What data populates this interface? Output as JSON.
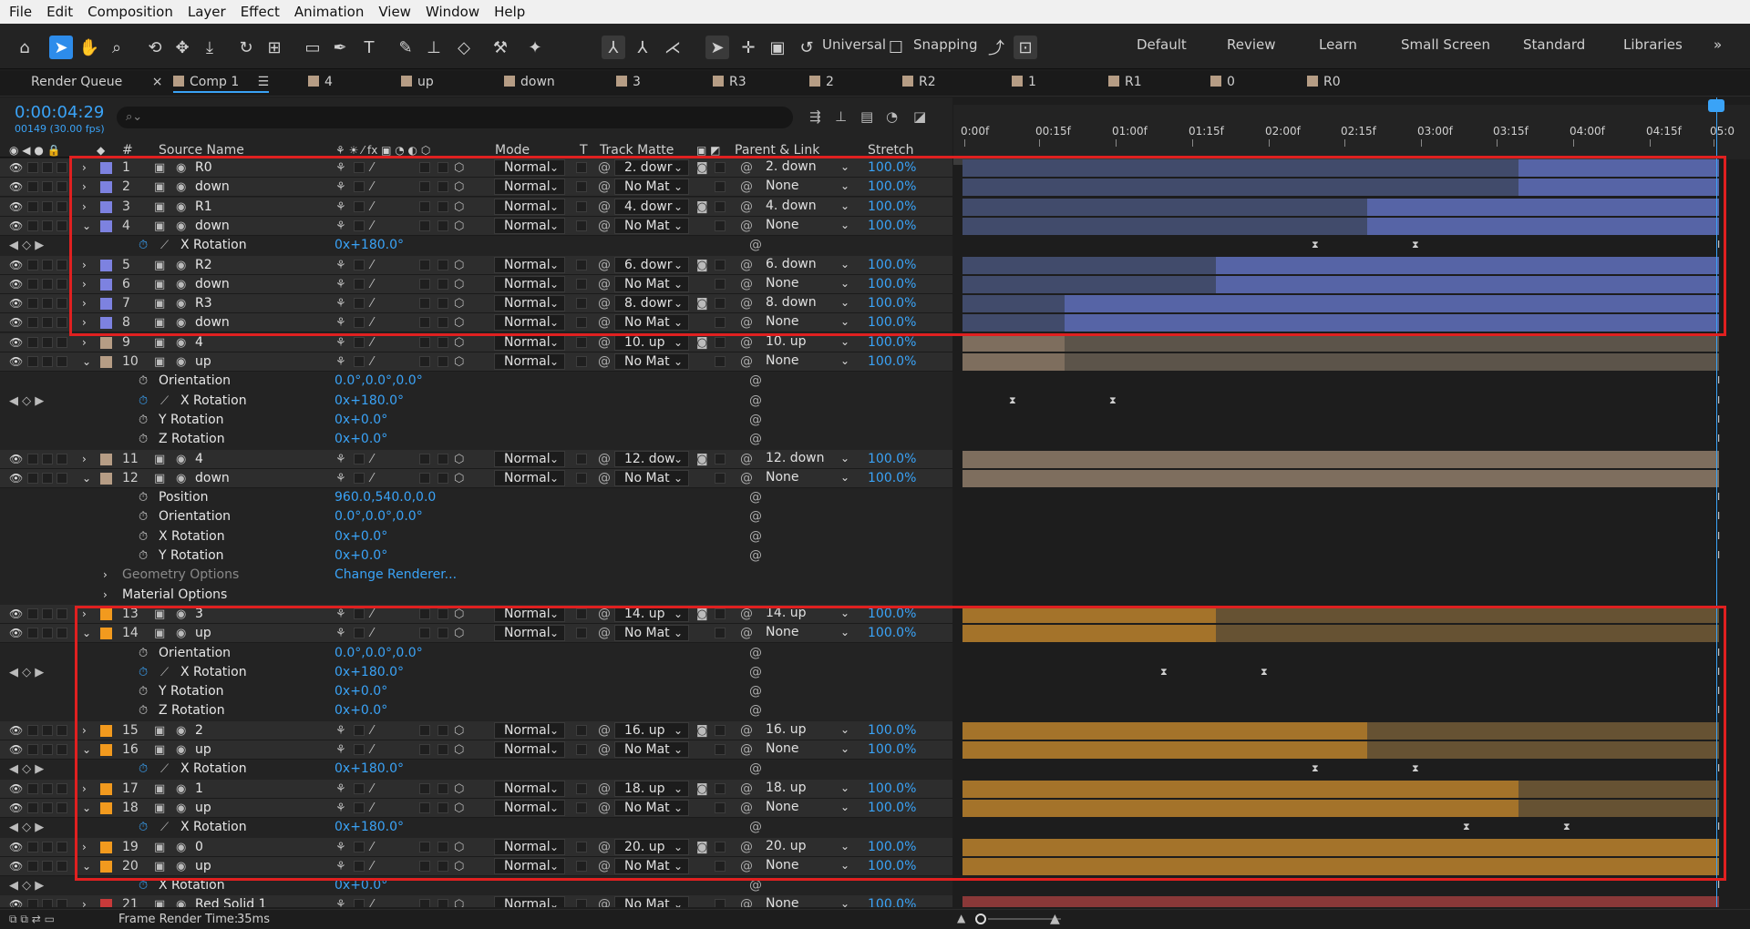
{
  "menu": [
    "File",
    "Edit",
    "Composition",
    "Layer",
    "Effect",
    "Animation",
    "View",
    "Window",
    "Help"
  ],
  "toolbar": {
    "universal_label": "Universal",
    "snapping_label": "Snapping",
    "workspaces": [
      "Default",
      "Review",
      "Learn",
      "Small Screen",
      "Standard",
      "Libraries"
    ],
    "more": "»"
  },
  "tabs": [
    {
      "label": "Render Queue",
      "color": null
    },
    {
      "label": "Comp 1",
      "color": "#b69d85",
      "active": true
    },
    {
      "label": "4",
      "color": "#b69d85"
    },
    {
      "label": "up",
      "color": "#b69d85"
    },
    {
      "label": "down",
      "color": "#b69d85"
    },
    {
      "label": "3",
      "color": "#b69d85"
    },
    {
      "label": "R3",
      "color": "#b69d85"
    },
    {
      "label": "2",
      "color": "#b69d85"
    },
    {
      "label": "R2",
      "color": "#b69d85"
    },
    {
      "label": "1",
      "color": "#b69d85"
    },
    {
      "label": "R1",
      "color": "#b69d85"
    },
    {
      "label": "0",
      "color": "#b69d85"
    },
    {
      "label": "R0",
      "color": "#b69d85"
    }
  ],
  "comp": {
    "timecode": "0:00:04:29",
    "fps": "00149 (30.00 fps)",
    "search_placeholder": "",
    "search_icon": "search-icon"
  },
  "columns": {
    "num": "#",
    "source_name": "Source Name",
    "mode": "Mode",
    "t": "T",
    "track_matte": "Track Matte",
    "parent_link": "Parent & Link",
    "stretch": "Stretch"
  },
  "ruler": [
    "0:00f",
    "00:15f",
    "01:00f",
    "01:15f",
    "02:00f",
    "02:15f",
    "03:00f",
    "03:15f",
    "04:00f",
    "04:15f",
    "05:0"
  ],
  "rows": [
    {
      "kind": "layer",
      "num": "1",
      "name": "R0",
      "color": "#7d82e0",
      "expanded": false,
      "mode": "Normal",
      "matte": "2. dowr",
      "matte_icon": true,
      "parent": "2. down",
      "stretch": "100.0%",
      "bar": {
        "start": 0,
        "end": 1,
        "hi": 0.735,
        "c1": "#414b6b",
        "c2": "#5664a6"
      }
    },
    {
      "kind": "layer",
      "num": "2",
      "name": "down",
      "color": "#7d82e0",
      "expanded": false,
      "mode": "Normal",
      "matte": "No Mat",
      "matte_icon": false,
      "parent": "None",
      "stretch": "100.0%",
      "bar": {
        "start": 0,
        "end": 1,
        "hi": 0.735,
        "c1": "#414b6b",
        "c2": "#5664a6"
      }
    },
    {
      "kind": "layer",
      "num": "3",
      "name": "R1",
      "color": "#7d82e0",
      "expanded": false,
      "mode": "Normal",
      "matte": "4. dowr",
      "matte_icon": true,
      "parent": "4. down",
      "stretch": "100.0%",
      "bar": {
        "start": 0,
        "end": 1,
        "hi": 0.535,
        "c1": "#414b6b",
        "c2": "#5664a6"
      }
    },
    {
      "kind": "layer",
      "num": "4",
      "name": "down",
      "color": "#7d82e0",
      "expanded": true,
      "mode": "Normal",
      "matte": "No Mat",
      "matte_icon": false,
      "parent": "None",
      "stretch": "100.0%",
      "bar": {
        "start": 0,
        "end": 1,
        "hi": 0.535,
        "c1": "#414b6b",
        "c2": "#5664a6"
      }
    },
    {
      "kind": "prop",
      "name": "X Rotation",
      "value": "0x+180.0°",
      "keyed": true,
      "graph": true,
      "keys": [
        0.468,
        0.6
      ]
    },
    {
      "kind": "layer",
      "num": "5",
      "name": "R2",
      "color": "#7d82e0",
      "expanded": false,
      "mode": "Normal",
      "matte": "6. dowr",
      "matte_icon": true,
      "parent": "6. down",
      "stretch": "100.0%",
      "bar": {
        "start": 0,
        "end": 1,
        "hi": 0.335,
        "c1": "#414b6b",
        "c2": "#5664a6"
      }
    },
    {
      "kind": "layer",
      "num": "6",
      "name": "down",
      "color": "#7d82e0",
      "expanded": false,
      "mode": "Normal",
      "matte": "No Mat",
      "matte_icon": false,
      "parent": "None",
      "stretch": "100.0%",
      "bar": {
        "start": 0,
        "end": 1,
        "hi": 0.335,
        "c1": "#414b6b",
        "c2": "#5664a6"
      }
    },
    {
      "kind": "layer",
      "num": "7",
      "name": "R3",
      "color": "#7d82e0",
      "expanded": false,
      "mode": "Normal",
      "matte": "8. dowr",
      "matte_icon": true,
      "parent": "8. down",
      "stretch": "100.0%",
      "bar": {
        "start": 0,
        "end": 1,
        "hi": 0.135,
        "c1": "#414b6b",
        "c2": "#5664a6"
      }
    },
    {
      "kind": "layer",
      "num": "8",
      "name": "down",
      "color": "#7d82e0",
      "expanded": false,
      "mode": "Normal",
      "matte": "No Mat",
      "matte_icon": false,
      "parent": "None",
      "stretch": "100.0%",
      "bar": {
        "start": 0,
        "end": 1,
        "hi": 0.135,
        "c1": "#414b6b",
        "c2": "#5664a6"
      }
    },
    {
      "kind": "layer",
      "num": "9",
      "name": "4",
      "color": "#b69d85",
      "expanded": false,
      "mode": "Normal",
      "matte": "10. up",
      "matte_icon": true,
      "parent": "10. up",
      "stretch": "100.0%",
      "bar": {
        "start": 0,
        "end": 1,
        "hi": 0.135,
        "c1": "#7e6e5e",
        "c2": "#5c544a",
        "rev": true
      }
    },
    {
      "kind": "layer",
      "num": "10",
      "name": "up",
      "color": "#b69d85",
      "expanded": true,
      "mode": "Normal",
      "matte": "No Mat",
      "matte_icon": false,
      "parent": "None",
      "stretch": "100.0%",
      "bar": {
        "start": 0,
        "end": 1,
        "hi": 0.135,
        "c1": "#7e6e5e",
        "c2": "#5c544a",
        "rev": true
      }
    },
    {
      "kind": "prop",
      "name": "Orientation",
      "value": "0.0°,0.0°,0.0°",
      "keyed": false
    },
    {
      "kind": "prop",
      "name": "X Rotation",
      "value": "0x+180.0°",
      "keyed": true,
      "graph": true,
      "keys": [
        0.068,
        0.2
      ]
    },
    {
      "kind": "prop",
      "name": "Y Rotation",
      "value": "0x+0.0°",
      "keyed": false
    },
    {
      "kind": "prop",
      "name": "Z Rotation",
      "value": "0x+0.0°",
      "keyed": false
    },
    {
      "kind": "layer",
      "num": "11",
      "name": "4",
      "color": "#b69d85",
      "expanded": false,
      "mode": "Normal",
      "matte": "12. dow",
      "matte_icon": true,
      "parent": "12. down",
      "stretch": "100.0%",
      "bar": {
        "start": 0,
        "end": 1,
        "hi": 0,
        "c1": "#7e6e5e",
        "c2": "#7e6e5e"
      }
    },
    {
      "kind": "layer",
      "num": "12",
      "name": "down",
      "color": "#b69d85",
      "expanded": true,
      "mode": "Normal",
      "matte": "No Mat",
      "matte_icon": false,
      "parent": "None",
      "stretch": "100.0%",
      "bar": {
        "start": 0,
        "end": 1,
        "hi": 0,
        "c1": "#7e6e5e",
        "c2": "#7e6e5e"
      }
    },
    {
      "kind": "prop",
      "name": "Position",
      "value": "960.0,540.0,0.0",
      "keyed": false
    },
    {
      "kind": "prop",
      "name": "Orientation",
      "value": "0.0°,0.0°,0.0°",
      "keyed": false
    },
    {
      "kind": "prop",
      "name": "X Rotation",
      "value": "0x+0.0°",
      "keyed": false
    },
    {
      "kind": "prop",
      "name": "Y Rotation",
      "value": "0x+0.0°",
      "keyed": false
    },
    {
      "kind": "group",
      "name": "Geometry Options",
      "value": "Change Renderer...",
      "dim": true
    },
    {
      "kind": "group",
      "name": "Material Options",
      "value": "",
      "dim": false
    },
    {
      "kind": "layer",
      "num": "13",
      "name": "3",
      "color": "#f29a1e",
      "expanded": false,
      "mode": "Normal",
      "matte": "14. up",
      "matte_icon": true,
      "parent": "14. up",
      "stretch": "100.0%",
      "bar": {
        "start": 0,
        "end": 1,
        "hi": 0.335,
        "c1": "#a4732a",
        "c2": "#665233",
        "rev": true
      }
    },
    {
      "kind": "layer",
      "num": "14",
      "name": "up",
      "color": "#f29a1e",
      "expanded": true,
      "mode": "Normal",
      "matte": "No Mat",
      "matte_icon": false,
      "parent": "None",
      "stretch": "100.0%",
      "bar": {
        "start": 0,
        "end": 1,
        "hi": 0.335,
        "c1": "#a4732a",
        "c2": "#665233",
        "rev": true
      }
    },
    {
      "kind": "prop",
      "name": "Orientation",
      "value": "0.0°,0.0°,0.0°",
      "keyed": false
    },
    {
      "kind": "prop",
      "name": "X Rotation",
      "value": "0x+180.0°",
      "keyed": true,
      "graph": true,
      "keys": [
        0.268,
        0.4
      ]
    },
    {
      "kind": "prop",
      "name": "Y Rotation",
      "value": "0x+0.0°",
      "keyed": false
    },
    {
      "kind": "prop",
      "name": "Z Rotation",
      "value": "0x+0.0°",
      "keyed": false
    },
    {
      "kind": "layer",
      "num": "15",
      "name": "2",
      "color": "#f29a1e",
      "expanded": false,
      "mode": "Normal",
      "matte": "16. up",
      "matte_icon": true,
      "parent": "16. up",
      "stretch": "100.0%",
      "bar": {
        "start": 0,
        "end": 1,
        "hi": 0.535,
        "c1": "#a4732a",
        "c2": "#665233",
        "rev": true
      }
    },
    {
      "kind": "layer",
      "num": "16",
      "name": "up",
      "color": "#f29a1e",
      "expanded": true,
      "mode": "Normal",
      "matte": "No Mat",
      "matte_icon": false,
      "parent": "None",
      "stretch": "100.0%",
      "bar": {
        "start": 0,
        "end": 1,
        "hi": 0.535,
        "c1": "#a4732a",
        "c2": "#665233",
        "rev": true
      }
    },
    {
      "kind": "prop",
      "name": "X Rotation",
      "value": "0x+180.0°",
      "keyed": true,
      "graph": true,
      "keys": [
        0.468,
        0.6
      ]
    },
    {
      "kind": "layer",
      "num": "17",
      "name": "1",
      "color": "#f29a1e",
      "expanded": false,
      "mode": "Normal",
      "matte": "18. up",
      "matte_icon": true,
      "parent": "18. up",
      "stretch": "100.0%",
      "bar": {
        "start": 0,
        "end": 1,
        "hi": 0.735,
        "c1": "#a4732a",
        "c2": "#665233",
        "rev": true
      }
    },
    {
      "kind": "layer",
      "num": "18",
      "name": "up",
      "color": "#f29a1e",
      "expanded": true,
      "mode": "Normal",
      "matte": "No Mat",
      "matte_icon": false,
      "parent": "None",
      "stretch": "100.0%",
      "bar": {
        "start": 0,
        "end": 1,
        "hi": 0.735,
        "c1": "#a4732a",
        "c2": "#665233",
        "rev": true
      }
    },
    {
      "kind": "prop",
      "name": "X Rotation",
      "value": "0x+180.0°",
      "keyed": true,
      "graph": true,
      "keys": [
        0.668,
        0.8
      ]
    },
    {
      "kind": "layer",
      "num": "19",
      "name": "0",
      "color": "#f29a1e",
      "expanded": false,
      "mode": "Normal",
      "matte": "20. up",
      "matte_icon": true,
      "parent": "20. up",
      "stretch": "100.0%",
      "bar": {
        "start": 0,
        "end": 1,
        "hi": 0,
        "c1": "#a4732a",
        "c2": "#a4732a"
      }
    },
    {
      "kind": "layer",
      "num": "20",
      "name": "up",
      "color": "#f29a1e",
      "expanded": true,
      "mode": "Normal",
      "matte": "No Mat",
      "matte_icon": false,
      "parent": "None",
      "stretch": "100.0%",
      "bar": {
        "start": 0,
        "end": 1,
        "hi": 0,
        "c1": "#a4732a",
        "c2": "#a4732a"
      }
    },
    {
      "kind": "prop",
      "name": "X Rotation",
      "value": "0x+0.0°",
      "keyed": true,
      "graph": false
    },
    {
      "kind": "layer",
      "num": "21",
      "name": "Red Solid 1",
      "color": "#c83a3a",
      "expanded": false,
      "mode": "Normal",
      "matte": "No Mat",
      "matte_icon": false,
      "parent": "None",
      "stretch": "100.0%",
      "bar": {
        "start": 0,
        "end": 1,
        "hi": 0,
        "c1": "#8a3838",
        "c2": "#8a3838"
      }
    }
  ],
  "status": {
    "frame_render_label": "Frame Render Time:",
    "frame_render_value": "35ms"
  }
}
